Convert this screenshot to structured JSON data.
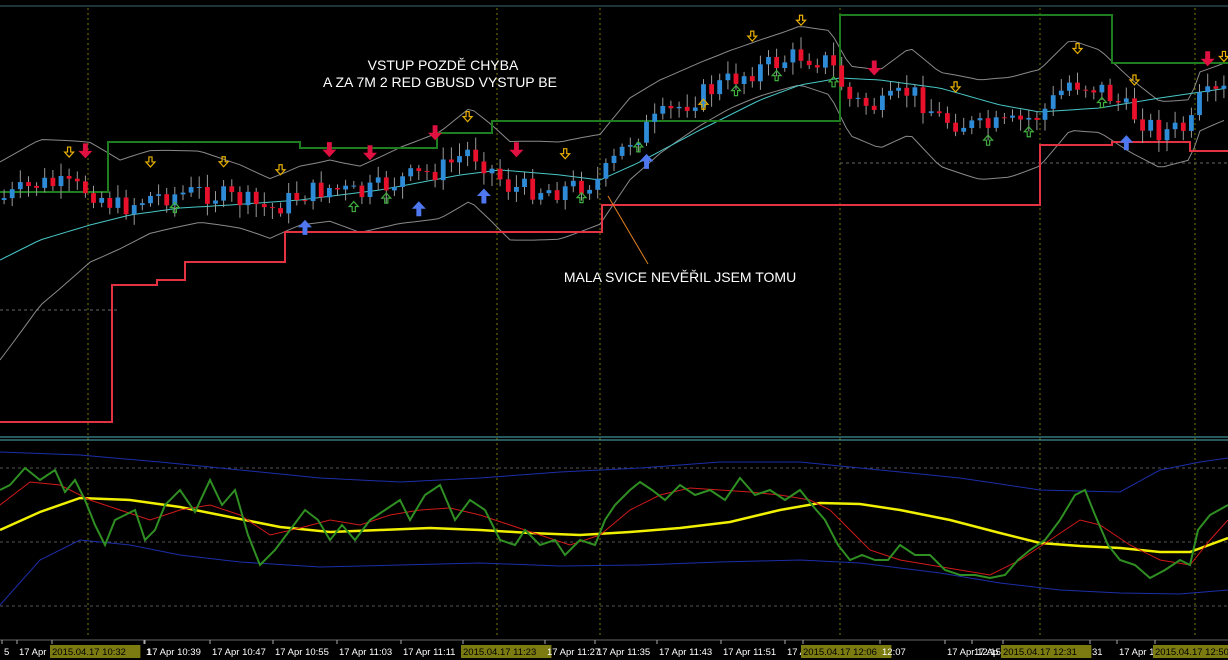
{
  "annotations": {
    "top_line1": "VSTUP POZDĚ CHYBA",
    "top_line2": "A ZA 7M 2 RED GBUSD VYSTUP BE",
    "candle_note": "MALA SVICE NEVĚŘIL JSEM TOMU"
  },
  "colors": {
    "background": "#000000",
    "grid": "#7a7a00",
    "bull_candle": "#2e8bd8",
    "bear_candle": "#e8102a",
    "bollinger": "#8a8a8a",
    "ma_cyan": "#49c6c6",
    "upper_stop": "#1e7d1e",
    "lower_stop": "#e33343",
    "osc_green": "#2f8f22",
    "osc_red": "#d11a1a",
    "osc_yellow": "#f0f000",
    "osc_blue": "#1c2ea8",
    "axis_text": "#ffffff",
    "panel_border": "#4fb0b8",
    "blue_arrow": "#4f78f0",
    "red_arrow": "#e01040",
    "yellow_arrow": "#e8b000",
    "green_arrow": "#3fae3f"
  },
  "x_axis": {
    "ticks": [
      {
        "label": "5"
      },
      {
        "label": "17 Apr"
      },
      {
        "label": "2015.04.17 10:32",
        "highlight": true
      },
      {
        "label": "1"
      },
      {
        "label": "17 Apr 10:39"
      },
      {
        "label": "17 Apr 10:47"
      },
      {
        "label": "17 Apr 10:55"
      },
      {
        "label": "17 Apr 11:03"
      },
      {
        "label": "17 Apr 11:11"
      },
      {
        "label": "2015.04.17 11:23",
        "highlight": true
      },
      {
        "label": "17 Apr 11:27"
      },
      {
        "label": "17 Apr 11:35"
      },
      {
        "label": "17 Apr 11:43"
      },
      {
        "label": "17 Apr 11:51"
      },
      {
        "label": "17 A"
      },
      {
        "label": "2015.04.17 12:06",
        "highlight": true
      },
      {
        "label": "12:07"
      },
      {
        "label": "17 Apr 12:15"
      },
      {
        "label": "17 Ap"
      },
      {
        "label": "2015.04.17 12:31",
        "highlight": true
      },
      {
        "label": "31"
      },
      {
        "label": "17 Apr 12:3"
      },
      {
        "label": "2015.04.17 12:50",
        "highlight": true
      }
    ]
  },
  "chart_data": [
    {
      "type": "candlestick",
      "panel": "price",
      "title": "",
      "candle_count": 151,
      "series": [
        {
          "kind": "bollinger_upper"
        },
        {
          "kind": "bollinger_lower"
        },
        {
          "kind": "moving_average"
        },
        {
          "kind": "upper_stop_step"
        },
        {
          "kind": "lower_stop_step"
        }
      ],
      "signal_arrows": {
        "blue_up": [
          37,
          51,
          59,
          79,
          138,
          162
        ],
        "red_down": [
          10,
          40,
          45,
          53,
          63,
          107,
          148
        ],
        "yellow_down": [
          8,
          18,
          27,
          34,
          57,
          69,
          92,
          98,
          117,
          132,
          139,
          150
        ],
        "yellow_up": [
          86
        ],
        "green_up": [
          21,
          43,
          47,
          71,
          78,
          90,
          95,
          102,
          121,
          126,
          135
        ]
      }
    },
    {
      "type": "line",
      "panel": "oscillator",
      "title": "",
      "series": [
        {
          "kind": "green_fast"
        },
        {
          "kind": "red_signal"
        },
        {
          "kind": "yellow_slow"
        },
        {
          "kind": "blue_upper_band"
        },
        {
          "kind": "blue_lower_band"
        }
      ]
    }
  ]
}
